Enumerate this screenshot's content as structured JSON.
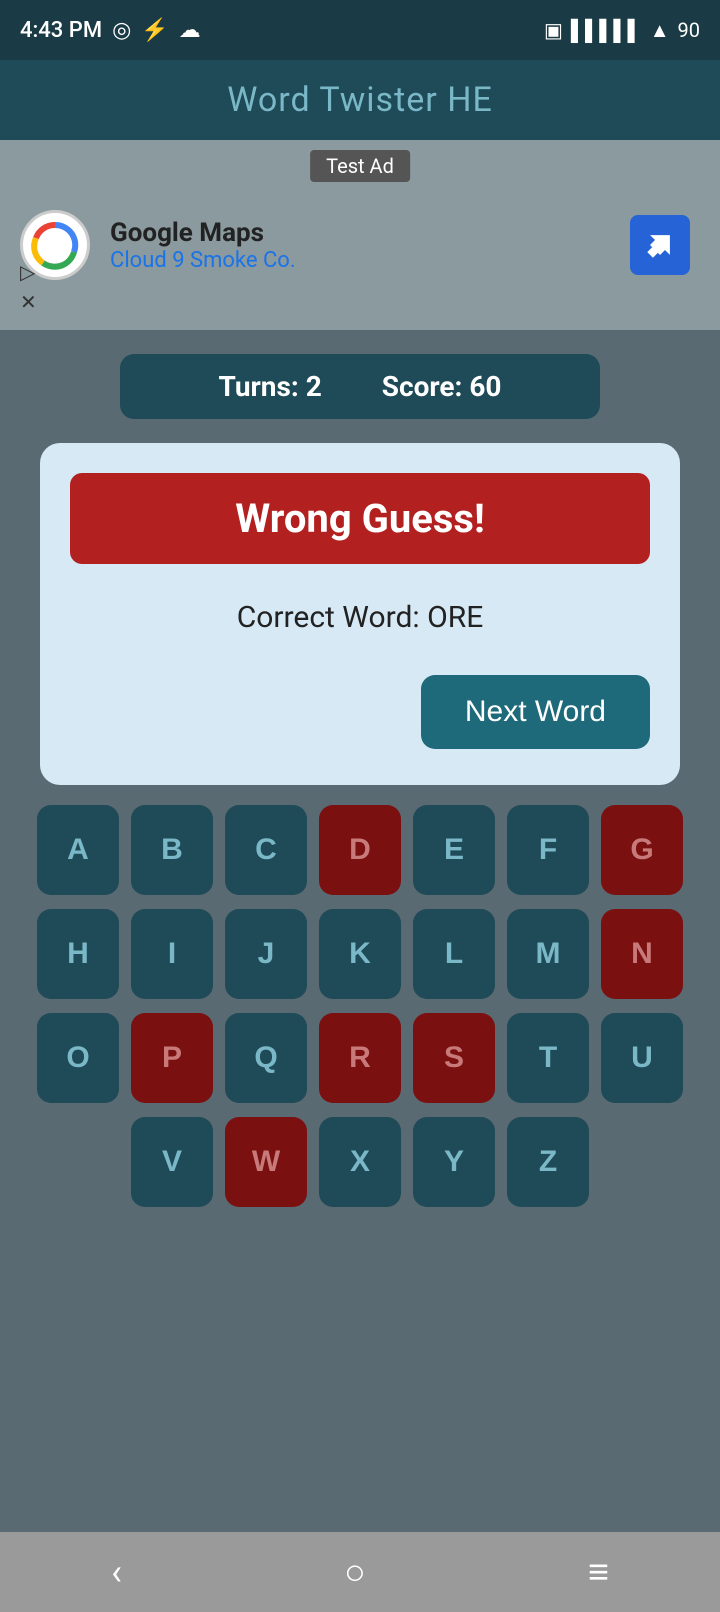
{
  "status": {
    "time": "4:43 PM",
    "battery": "90"
  },
  "app": {
    "title": "Word Twister HE"
  },
  "ad": {
    "label": "Test Ad",
    "company": "Google Maps",
    "subtitle": "Cloud 9 Smoke Co."
  },
  "score_bar": {
    "turns_label": "Turns:",
    "turns_value": "2",
    "score_label": "Score:",
    "score_value": "60"
  },
  "dialog": {
    "wrong_guess": "Wrong Guess!",
    "correct_word_prefix": "Correct Word: ",
    "correct_word": "ORE",
    "next_button": "Next Word"
  },
  "keyboard": {
    "rows": [
      [
        "A",
        "B",
        "C",
        "D",
        "E",
        "F",
        "G"
      ],
      [
        "H",
        "I",
        "J",
        "K",
        "L",
        "M",
        "N"
      ],
      [
        "O",
        "P",
        "Q",
        "R",
        "S",
        "T",
        "U"
      ],
      [
        "V",
        "W",
        "X",
        "Y",
        "Z"
      ]
    ],
    "used": [
      "D",
      "G",
      "N",
      "P",
      "R",
      "S",
      "W"
    ]
  },
  "nav": {
    "back": "‹",
    "home": "○",
    "menu": "≡"
  }
}
